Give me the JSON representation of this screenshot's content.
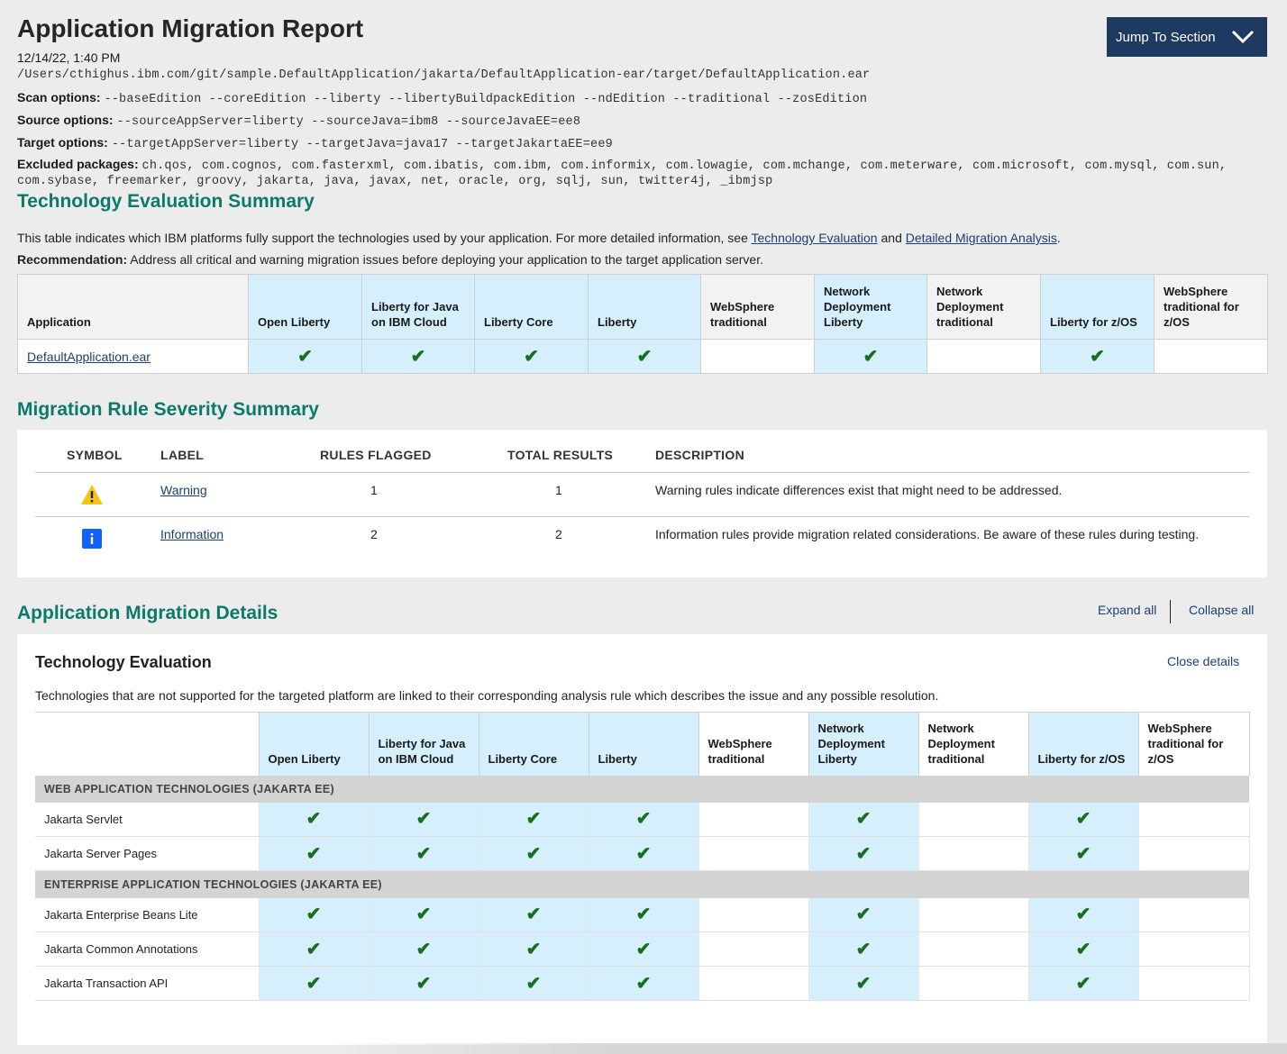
{
  "report": {
    "title": "Application Migration Report",
    "date": "12/14/22, 1:40 PM",
    "path": "/Users/cthighus.ibm.com/git/sample.DefaultApplication/jakarta/DefaultApplication-ear/target/DefaultApplication.ear",
    "scan_label": "Scan options:",
    "scan_value": "--baseEdition --coreEdition --liberty --libertyBuildpackEdition --ndEdition --traditional --zosEdition",
    "source_label": "Source options:",
    "source_value": "--sourceAppServer=liberty --sourceJava=ibm8 --sourceJavaEE=ee8",
    "target_label": "Target options:",
    "target_value": "--targetAppServer=liberty --targetJava=java17 --targetJakartaEE=ee9",
    "excluded_label": "Excluded packages:",
    "excluded_value": "ch.qos, com.cognos, com.fasterxml, com.ibatis, com.ibm, com.informix, com.lowagie, com.mchange, com.meterware, com.microsoft, com.mysql, com.sun, com.sybase, freemarker, groovy, jakarta, java, javax, net, oracle, org, sqlj, sun, twitter4j, _ibmjsp"
  },
  "jump_button": {
    "label": "Jump To Section",
    "icon": "chevron-down-icon"
  },
  "colors": {
    "accent": "#0b7a6b",
    "button_bg": "#1f3a60",
    "supported_bg": "#d5effc",
    "check": "#1a6e1f",
    "warning": "#f3c417",
    "info": "#0f62fe"
  },
  "tech_summary": {
    "heading": "Technology Evaluation Summary",
    "desc_prefix": "This table indicates which IBM platforms fully support the technologies used by your application. For more detailed information, see",
    "link1": "Technology Evaluation",
    "desc_and": "and",
    "link2": "Detailed Migration Analysis",
    "desc_suffix": ".",
    "rec_label": "Recommendation:",
    "rec_text": "Address all critical and warning migration issues before deploying your application to the target application server.",
    "app_header": "Application",
    "app_name": "DefaultApplication.ear"
  },
  "platforms": [
    {
      "name": "Open Liberty",
      "supported": true
    },
    {
      "name": "Liberty for Java on IBM Cloud",
      "supported": true
    },
    {
      "name": "Liberty Core",
      "supported": true
    },
    {
      "name": "Liberty",
      "supported": true
    },
    {
      "name": "WebSphere traditional",
      "supported": false
    },
    {
      "name": "Network Deployment Liberty",
      "supported": true
    },
    {
      "name": "Network Deployment traditional",
      "supported": false
    },
    {
      "name": "Liberty for z/OS",
      "supported": true
    },
    {
      "name": "WebSphere traditional for z/OS",
      "supported": false
    }
  ],
  "check_glyph": "✔",
  "severity": {
    "heading": "Migration Rule Severity Summary",
    "headers": {
      "symbol": "SYMBOL",
      "label": "LABEL",
      "rules": "RULES FLAGGED",
      "total": "TOTAL RESULTS",
      "description": "DESCRIPTION"
    },
    "rows": [
      {
        "icon": "warning-icon",
        "label": "Warning",
        "rules": "1",
        "total": "1",
        "description": "Warning rules indicate differences exist that might need to be addressed."
      },
      {
        "icon": "info-icon",
        "label": "Information",
        "rules": "2",
        "total": "2",
        "description": "Information rules provide migration related considerations. Be aware of these rules during testing."
      }
    ]
  },
  "details": {
    "heading": "Application Migration Details",
    "expand_all": "Expand all",
    "collapse_all": "Collapse all",
    "tech_eval_title": "Technology Evaluation",
    "close_details": "Close details",
    "tech_eval_desc": "Technologies that are not supported for the targeted platform are linked to their corresponding analysis rule which describes the issue and any possible resolution.",
    "categories": [
      {
        "name": "WEB APPLICATION TECHNOLOGIES (JAKARTA EE)",
        "techs": [
          "Jakarta Servlet",
          "Jakarta Server Pages"
        ]
      },
      {
        "name": "ENTERPRISE APPLICATION TECHNOLOGIES (JAKARTA EE)",
        "techs": [
          "Jakarta Enterprise Beans Lite",
          "Jakarta Common Annotations",
          "Jakarta Transaction API"
        ]
      }
    ]
  }
}
